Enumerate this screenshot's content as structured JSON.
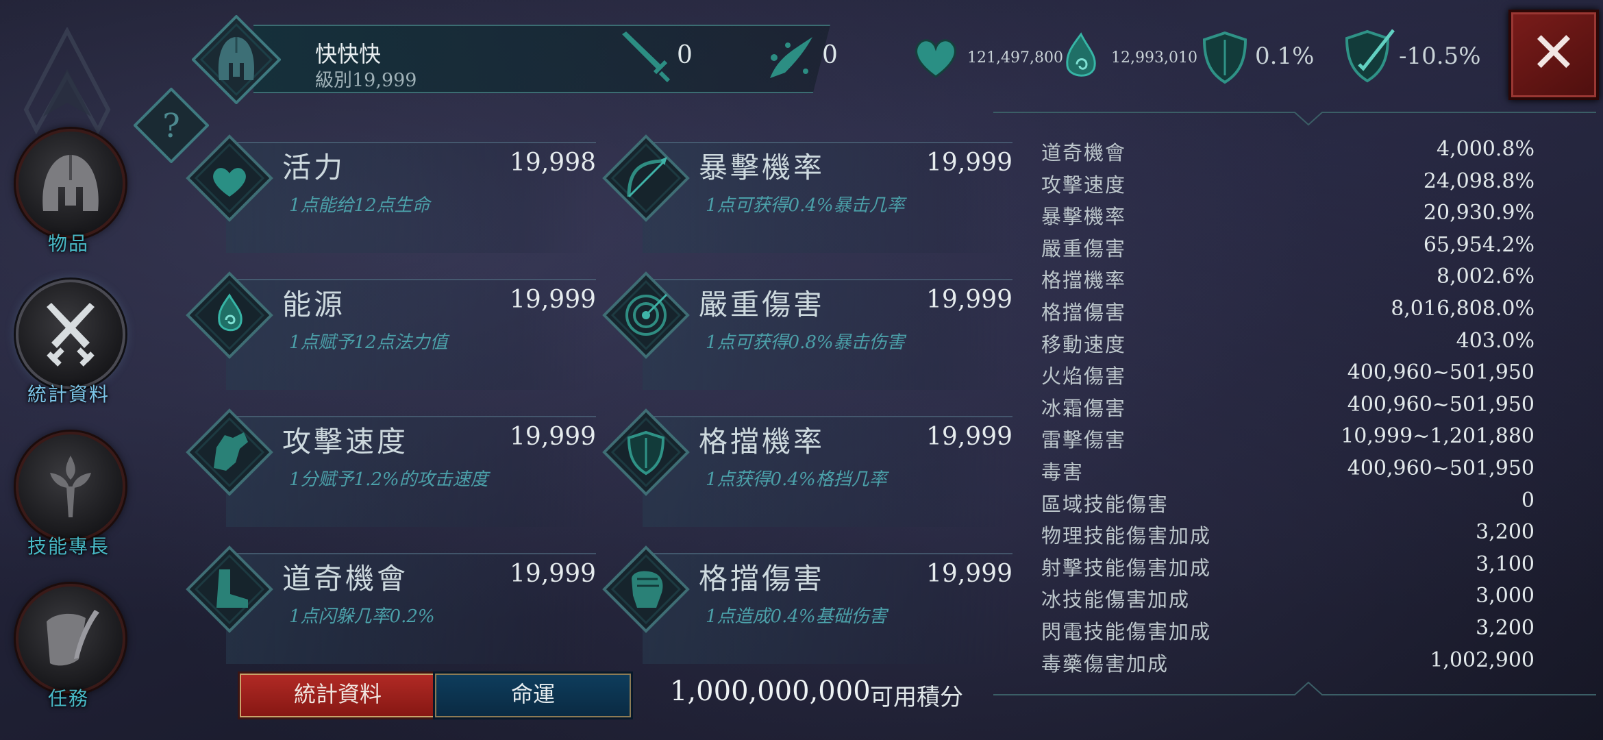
{
  "header": {
    "name": "快快快",
    "level": "級別19,999",
    "attack_value": "0",
    "splash_value": "0"
  },
  "summary": {
    "health": "121,497,800",
    "energy": "12,993,010",
    "defense": "0.1%",
    "resistance": "-10.5%"
  },
  "nav": [
    {
      "label": "物品",
      "icon": "helmet-icon"
    },
    {
      "label": "統計資料",
      "icon": "crossed-swords-icon"
    },
    {
      "label": "技能專長",
      "icon": "fleur-dagger-icon"
    },
    {
      "label": "任務",
      "icon": "scroll-quill-icon"
    }
  ],
  "stats_cards": [
    {
      "title": "活力",
      "value": "19,998",
      "desc": "1点能给12点生命",
      "icon": "heart-icon"
    },
    {
      "title": "暴擊機率",
      "value": "19,999",
      "desc": "1点可获得0.4%暴击几率",
      "icon": "bow-icon"
    },
    {
      "title": "能源",
      "value": "19,999",
      "desc": "1点赋予12点法力值",
      "icon": "energy-swirl-icon"
    },
    {
      "title": "嚴重傷害",
      "value": "19,999",
      "desc": "1点可获得0.8%暴击伤害",
      "icon": "target-icon"
    },
    {
      "title": "攻擊速度",
      "value": "19,999",
      "desc": "1分赋予1.2%的攻击速度",
      "icon": "gauntlet-icon"
    },
    {
      "title": "格擋機率",
      "value": "19,999",
      "desc": "1点获得0.4%格挡几率",
      "icon": "shield-icon"
    },
    {
      "title": "道奇機會",
      "value": "19,999",
      "desc": "1点闪躲几率0.2%",
      "icon": "boot-icon"
    },
    {
      "title": "格擋傷害",
      "value": "19,999",
      "desc": "1点造成0.4%基础伤害",
      "icon": "fist-icon"
    }
  ],
  "tabs": {
    "stats": "統計資料",
    "fate": "命運"
  },
  "points": {
    "value": "1,000,000,000",
    "label": "可用積分"
  },
  "stat_list": [
    {
      "label": "道奇機會",
      "value": "4,000.8%"
    },
    {
      "label": "攻擊速度",
      "value": "24,098.8%"
    },
    {
      "label": "暴擊機率",
      "value": "20,930.9%"
    },
    {
      "label": "嚴重傷害",
      "value": "65,954.2%"
    },
    {
      "label": "格擋機率",
      "value": "8,002.6%"
    },
    {
      "label": "格擋傷害",
      "value": "8,016,808.0%"
    },
    {
      "label": "移動速度",
      "value": "403.0%"
    },
    {
      "label": "火焰傷害",
      "value": "400,960~501,950"
    },
    {
      "label": "冰霜傷害",
      "value": "400,960~501,950"
    },
    {
      "label": "雷擊傷害",
      "value": "10,999~1,201,880"
    },
    {
      "label": "毒害",
      "value": "400,960~501,950"
    },
    {
      "label": "區域技能傷害",
      "value": "0"
    },
    {
      "label": "物理技能傷害加成",
      "value": "3,200"
    },
    {
      "label": "射擊技能傷害加成",
      "value": "3,100"
    },
    {
      "label": "冰技能傷害加成",
      "value": "3,000"
    },
    {
      "label": "閃電技能傷害加成",
      "value": "3,200"
    },
    {
      "label": "毒藥傷害加成",
      "value": "1,002,900"
    }
  ],
  "colors": {
    "accent_teal": "#3fb3a8",
    "label_teal": "#48b9c6",
    "close_red": "#7a1c1a",
    "tab_red": "#b22a25",
    "tab_blue": "#0e3d5d"
  }
}
